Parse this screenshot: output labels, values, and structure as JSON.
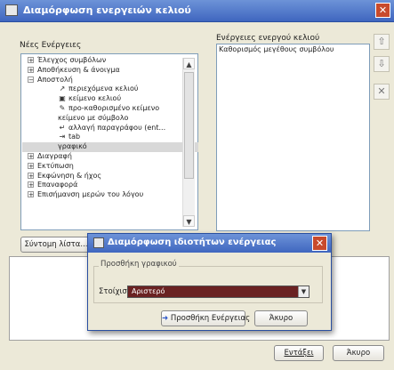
{
  "window": {
    "title": "Διαμόρφωση ενεργειών κελιού",
    "close_icon": "close-icon"
  },
  "left": {
    "label": "Νέες Ενέργειες",
    "tree": [
      {
        "level": 0,
        "exp": "+",
        "text": "Έλεγχος συμβόλων"
      },
      {
        "level": 0,
        "exp": "+",
        "text": "Αποθήκευση & άνοιγμα"
      },
      {
        "level": 0,
        "exp": "−",
        "text": "Αποστολή"
      },
      {
        "level": 1,
        "icon": "arrow-icon",
        "text": "περιεχόμενα κελιού"
      },
      {
        "level": 1,
        "icon": "cell-icon",
        "text": "κείμενο κελιού"
      },
      {
        "level": 1,
        "icon": "predefined-text-icon",
        "text": "προ-καθορισμένο κείμενο"
      },
      {
        "level": 1,
        "text": "κείμενο με σύμβολο"
      },
      {
        "level": 1,
        "icon": "paragraph-icon",
        "text": "αλλαγή παραγράφου (ent..."
      },
      {
        "level": 1,
        "icon": "tab-icon",
        "text": "tab"
      },
      {
        "level": 1,
        "text": "γραφικό",
        "selected": true
      },
      {
        "level": 0,
        "exp": "+",
        "text": "Διαγραφή"
      },
      {
        "level": 0,
        "exp": "+",
        "text": "Εκτύπωση"
      },
      {
        "level": 0,
        "exp": "+",
        "text": "Εκφώνηση & ήχος"
      },
      {
        "level": 0,
        "exp": "+",
        "text": "Επαναφορά"
      },
      {
        "level": 0,
        "exp": "+",
        "text": "Επισήμανση μερών του λόγου"
      }
    ],
    "shortcut_button": "Σύντομη λίστα..."
  },
  "right": {
    "label": "Ενέργειες ενεργού κελιού",
    "items": [
      "Καθορισμός μεγέθους συμβόλου"
    ]
  },
  "side_buttons": [
    {
      "name": "move-up-button",
      "icon": "arrow-up-icon",
      "glyph": "⇧"
    },
    {
      "name": "move-down-button",
      "icon": "arrow-down-icon",
      "glyph": "⇩"
    },
    {
      "name": "remove-button",
      "icon": "x-icon",
      "glyph": "✕"
    }
  ],
  "modal": {
    "title": "Διαμόρφωση ιδιοτήτων ενέργειας",
    "group_label": "Προσθήκη γραφικού",
    "align_label": "Στοίχιση",
    "align_value": "Αριστερό",
    "add_button": "Προσθήκη Ενέργειας",
    "cancel_button": "Άκυρο"
  },
  "footer": {
    "ok_button": "Εντάξει",
    "cancel_button": "Άκυρο"
  }
}
